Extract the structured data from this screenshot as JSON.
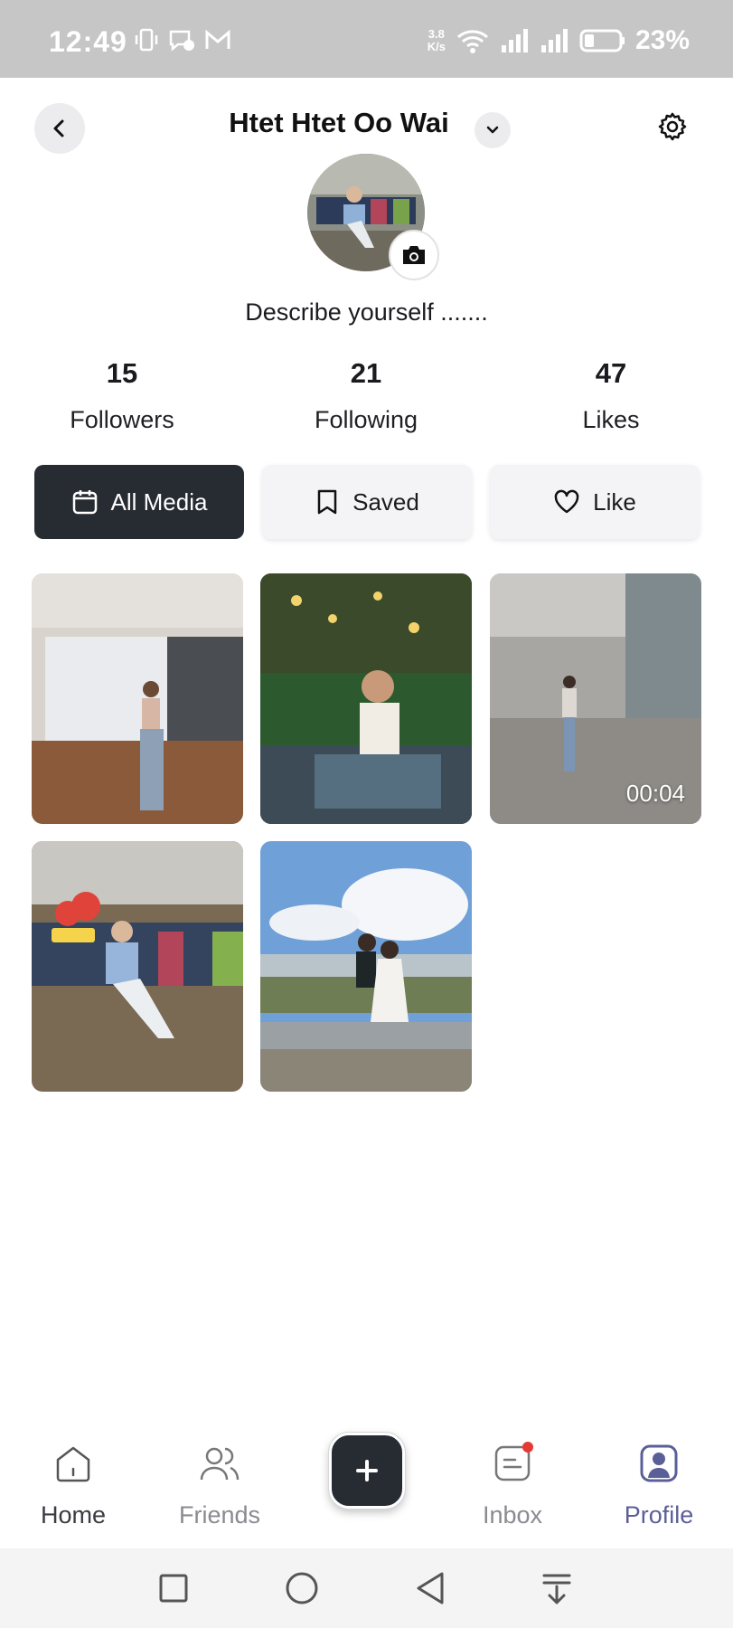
{
  "status_bar": {
    "time": "12:49",
    "network_speed_value": "3.8",
    "network_speed_unit": "K/s",
    "battery_percent": "23%"
  },
  "header": {
    "username": "Htet Htet Oo Wai"
  },
  "profile": {
    "bio": "Describe yourself ......."
  },
  "stats": [
    {
      "value": "15",
      "label": "Followers"
    },
    {
      "value": "21",
      "label": "Following"
    },
    {
      "value": "47",
      "label": "Likes"
    }
  ],
  "tabs": [
    {
      "label": "All Media",
      "icon": "calendar-icon",
      "active": true
    },
    {
      "label": "Saved",
      "icon": "bookmark-icon",
      "active": false
    },
    {
      "label": "Like",
      "icon": "heart-icon",
      "active": false
    }
  ],
  "media": [
    {
      "type": "photo"
    },
    {
      "type": "photo"
    },
    {
      "type": "video",
      "duration": "00:04"
    },
    {
      "type": "photo"
    },
    {
      "type": "photo"
    }
  ],
  "bottom_nav": [
    {
      "label": "Home",
      "icon": "home-icon"
    },
    {
      "label": "Friends",
      "icon": "friends-icon"
    },
    {
      "label": "Inbox",
      "icon": "inbox-icon",
      "badge": true
    },
    {
      "label": "Profile",
      "icon": "profile-icon",
      "active": true
    }
  ],
  "colors": {
    "accent": "#5b5f97",
    "dark": "#272b32",
    "badge": "#e53935",
    "status_bar": "#c6c6c6"
  }
}
